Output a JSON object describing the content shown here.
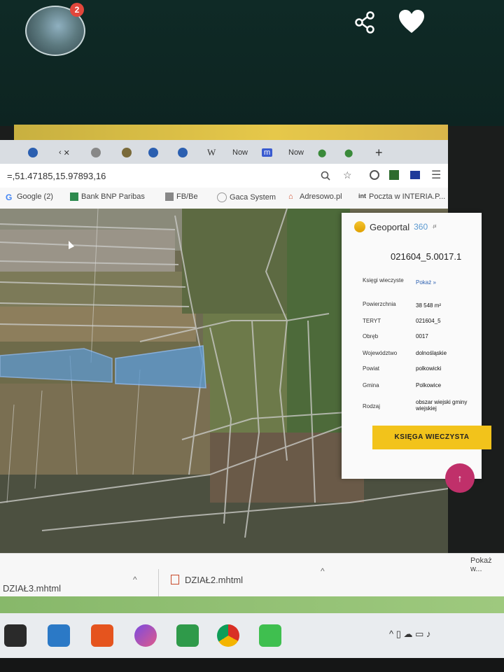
{
  "phone_bar": {
    "notification_count": "2",
    "share_icon": "share-icon",
    "heart_icon": "heart-icon"
  },
  "browser": {
    "tabs": [
      {
        "label": "",
        "icon": "app-icon"
      },
      {
        "label": "",
        "icon": "back-icon"
      },
      {
        "label": "",
        "icon": "cloud-icon"
      },
      {
        "label": "",
        "icon": "app-icon"
      },
      {
        "label": "",
        "icon": "app-icon"
      },
      {
        "label": "W",
        "icon": "wiki-icon"
      },
      {
        "label": "Now",
        "icon": "page-icon"
      },
      {
        "label": "m",
        "icon": "m-icon"
      },
      {
        "label": "Now",
        "icon": "page-icon"
      },
      {
        "label": "",
        "icon": "map-pin-icon"
      },
      {
        "label": "",
        "icon": "map-pin-icon"
      },
      {
        "label": "+",
        "icon": "new-tab-icon"
      }
    ],
    "url": "=,51.47185,15.97893,16",
    "bookmarks": [
      {
        "label": "Google (2)",
        "icon": "google-icon"
      },
      {
        "label": "Bank BNP Paribas",
        "icon": "bank-icon"
      },
      {
        "label": "FB/Be",
        "icon": "fb-icon"
      },
      {
        "label": "Gaca System",
        "icon": "system-icon"
      },
      {
        "label": "Adresowo.pl",
        "icon": "house-icon"
      },
      {
        "label": "Poczta w INTERIA.P...",
        "icon": "mail-icon"
      }
    ]
  },
  "geoportal": {
    "logo_text": "Geoportal",
    "logo_suffix": "360",
    "logo_tld": ".pl",
    "parcel_id": "021604_5.0017.1",
    "rows": [
      {
        "label": "Księgi wieczyste",
        "value": "Pokaż »"
      },
      {
        "label": "Powierzchnia",
        "value": "38 548 m²"
      },
      {
        "label": "TERYT",
        "value": "021604_5"
      },
      {
        "label": "Obręb",
        "value": "0017"
      },
      {
        "label": "Województwo",
        "value": "dolnośląskie"
      },
      {
        "label": "Powiat",
        "value": "polkowicki"
      },
      {
        "label": "Gmina",
        "value": "Polkowice"
      },
      {
        "label": "Rodzaj",
        "value": "obszar wiejski gminy wiejskiej"
      }
    ],
    "button": "KSIĘGA WIECZYSTA",
    "fab": "↑"
  },
  "downloads": {
    "items": [
      "DZIAŁ3.mhtml",
      "DZIAŁ2.mhtml"
    ],
    "show_all": "Pokaż w..."
  },
  "colors": {
    "parcel_fill": "#5f9ad1",
    "button_yellow": "#f2c31b",
    "fab_pink": "#c0306a"
  }
}
